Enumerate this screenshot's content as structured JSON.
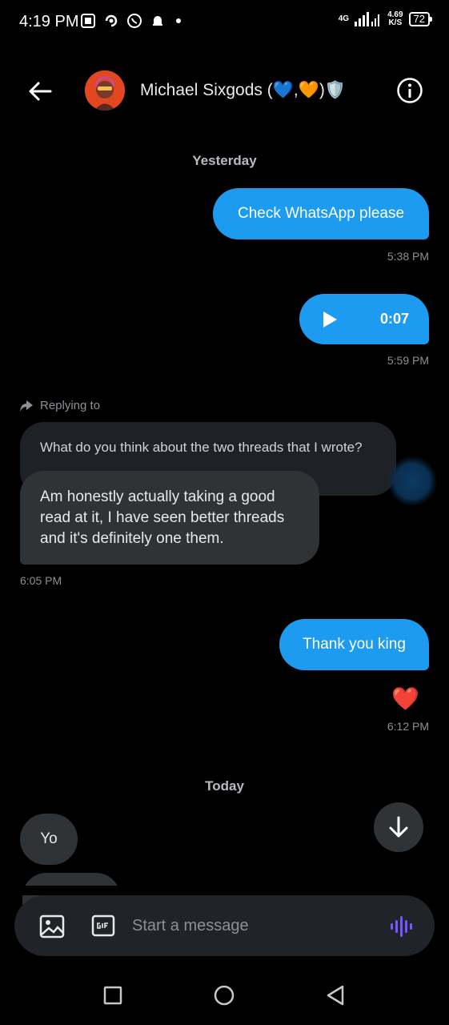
{
  "status_bar": {
    "time": "4:19 PM",
    "network": "4G",
    "speed_value": "4.69",
    "speed_unit": "K/S",
    "battery": "72"
  },
  "header": {
    "contact_name": "Michael Sixgods (💙,🧡)🛡️"
  },
  "conversation": {
    "day_1": "Yesterday",
    "out_1": {
      "text": "Check WhatsApp please",
      "time": "5:38 PM"
    },
    "voice_note": {
      "duration": "0:07",
      "time": "5:59 PM"
    },
    "reply_label": "Replying to",
    "quoted_text": "What do you think about the two threads that I wrote?",
    "in_reply": {
      "text": "Am honestly actually taking a good read at it, I have seen better threads and it's definitely one them.",
      "time": "6:05 PM"
    },
    "out_2": {
      "text": "Thank you king",
      "reaction": "❤️",
      "time": "6:12 PM"
    },
    "day_2": "Today",
    "in_2": {
      "text": "Yo"
    }
  },
  "composer": {
    "placeholder": "Start a message"
  },
  "colors": {
    "accent": "#1d9bf0",
    "bubble_in": "#2f3336",
    "background": "#000000",
    "voice_accent": "#7856ff"
  }
}
